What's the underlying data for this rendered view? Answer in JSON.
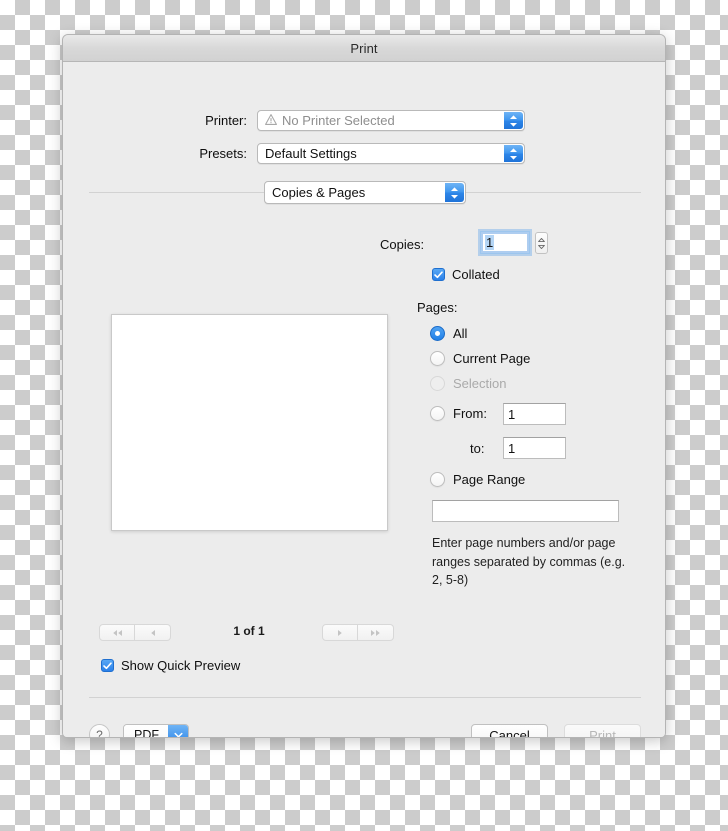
{
  "window": {
    "title": "Print"
  },
  "printer_row": {
    "label": "Printer:",
    "value": "No Printer Selected",
    "icon": "warning-triangle-icon"
  },
  "presets_row": {
    "label": "Presets:",
    "value": "Default Settings"
  },
  "pane_popup": {
    "value": "Copies & Pages"
  },
  "copies": {
    "label": "Copies:",
    "value": "1",
    "stepper_icon": "stepper-up-down-icon",
    "collated": {
      "label": "Collated",
      "checked": true
    }
  },
  "pages": {
    "label": "Pages:",
    "options": [
      {
        "label": "All",
        "selected": true,
        "disabled": false
      },
      {
        "label": "Current Page",
        "selected": false,
        "disabled": false
      },
      {
        "label": "Selection",
        "selected": false,
        "disabled": true
      },
      {
        "label": "From:",
        "selected": false,
        "disabled": false
      },
      {
        "label": "Page Range",
        "selected": false,
        "disabled": false
      }
    ],
    "from_value": "1",
    "to_label": "to:",
    "to_value": "1",
    "range_value": "",
    "hint": "Enter page numbers and/or page ranges separated by commas (e.g. 2, 5-8)"
  },
  "preview": {
    "page_indicator": "1 of 1",
    "nav": {
      "first": "first-page-icon",
      "previous": "previous-page-icon",
      "next": "next-page-icon",
      "last": "last-page-icon"
    },
    "quick_preview": {
      "label": "Show Quick Preview",
      "checked": true
    }
  },
  "footer": {
    "help_label": "?",
    "pdf_label": "PDF",
    "cancel_label": "Cancel",
    "print_label": "Print"
  },
  "colors": {
    "accent": "#2e86e8",
    "window_bg": "#ececec",
    "titlebar": "#d8d8d8",
    "disabled_text": "#aaaaaa"
  }
}
